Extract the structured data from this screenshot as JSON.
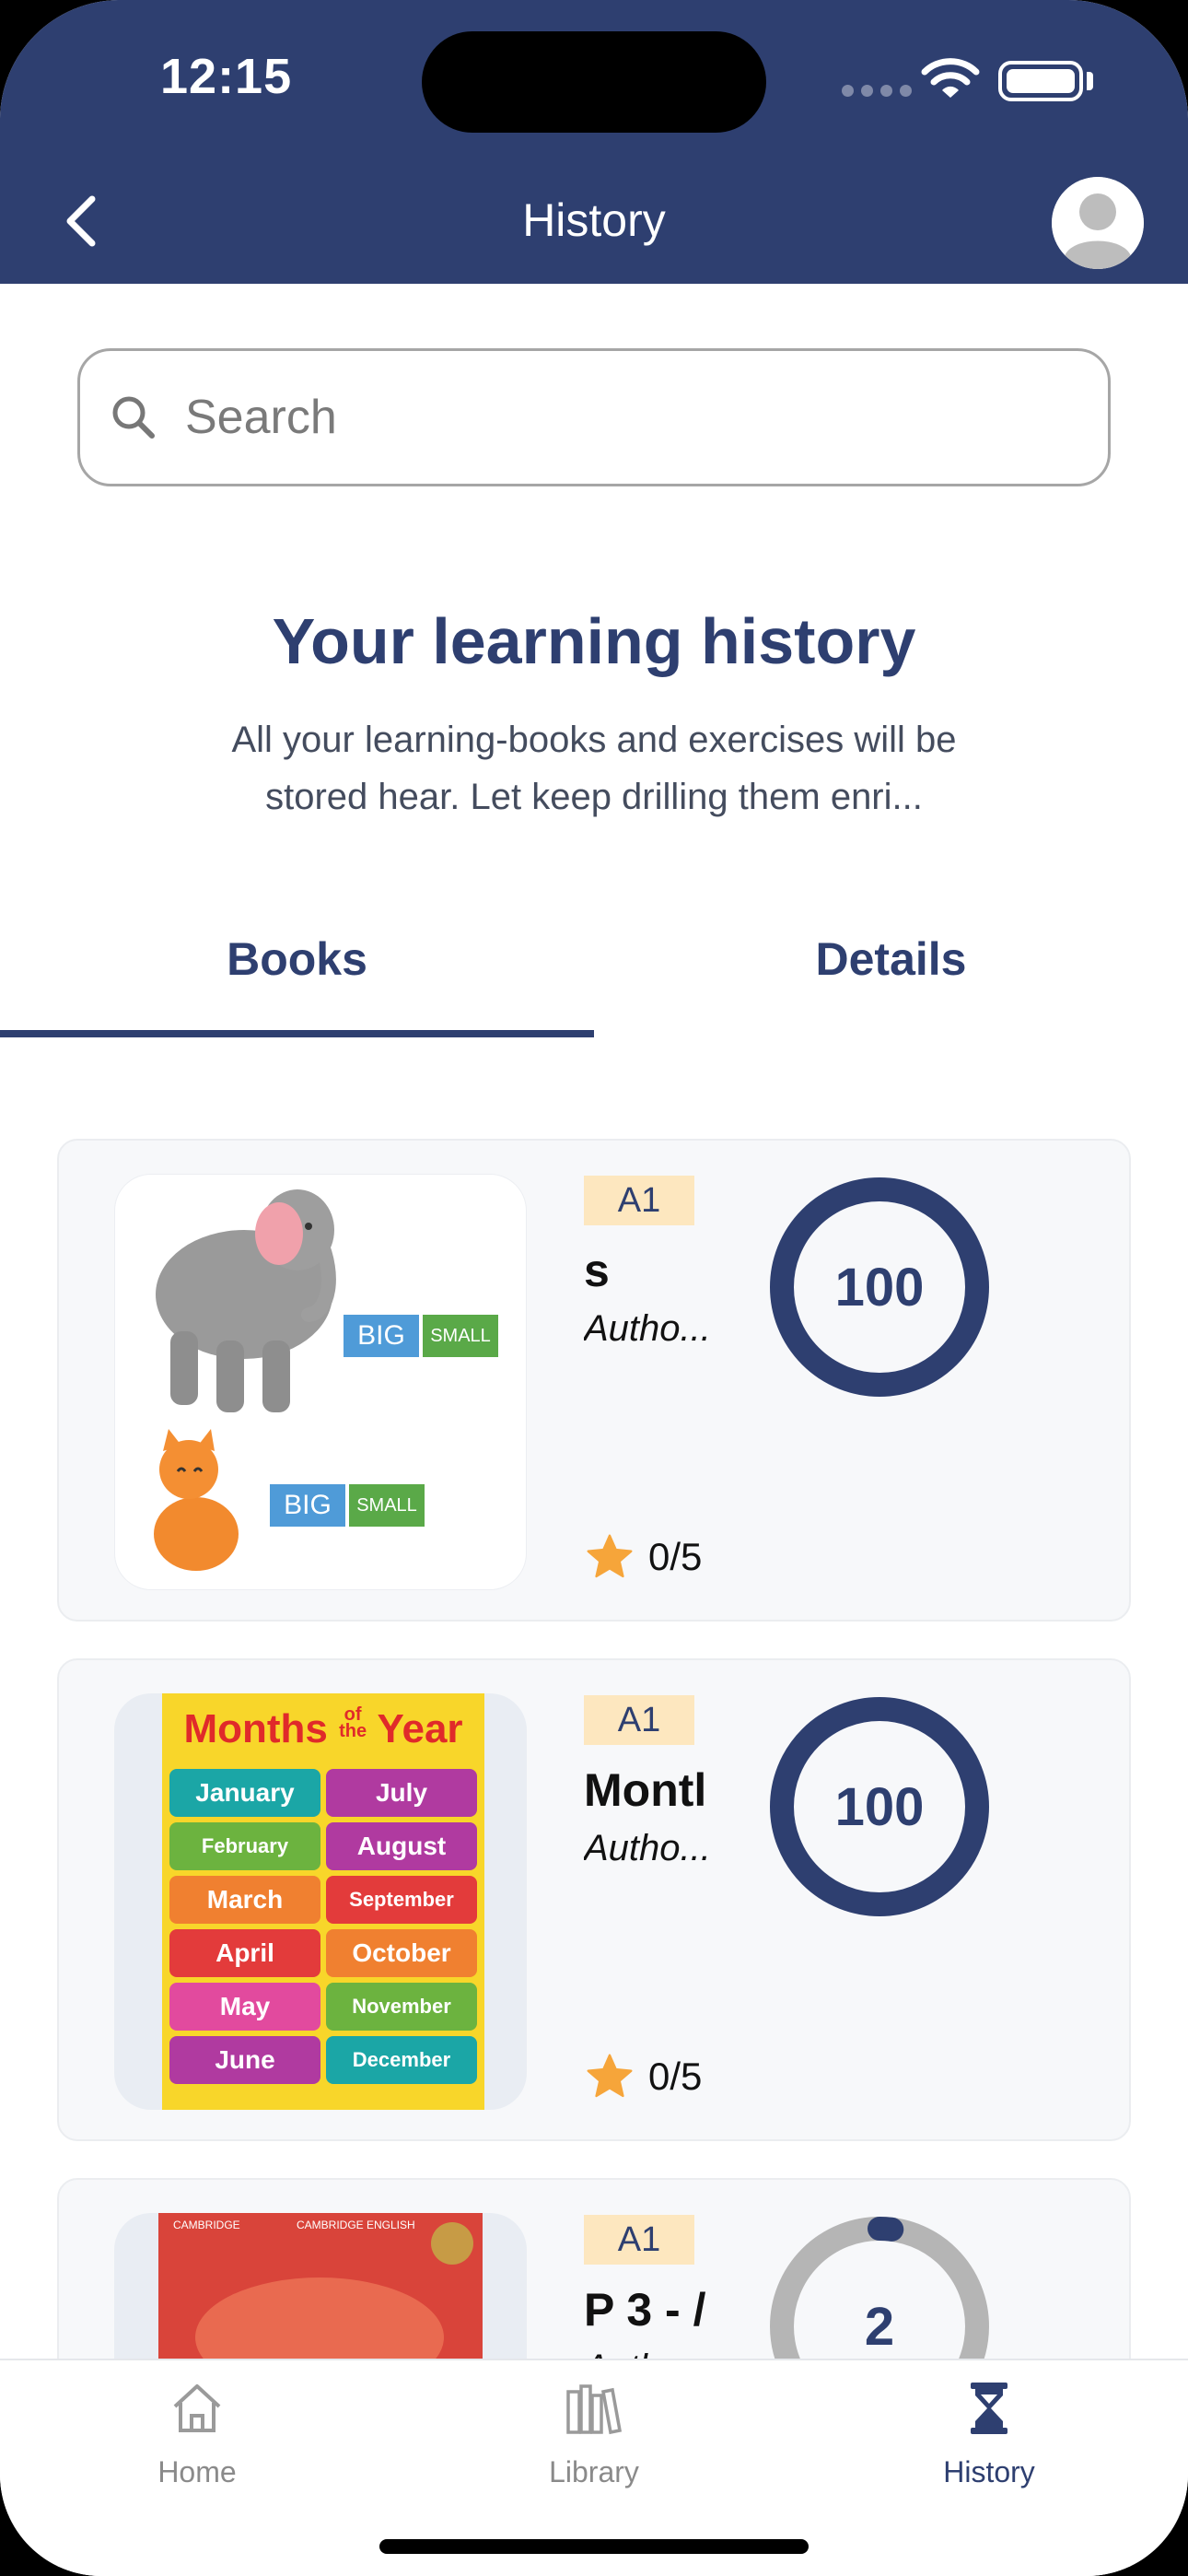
{
  "status_bar": {
    "time": "12:15"
  },
  "header": {
    "title": "History"
  },
  "search": {
    "placeholder": "Search"
  },
  "hero": {
    "title": "Your learning history",
    "description": "All your learning-books and exercises will be stored hear. Let keep drilling them enri..."
  },
  "tabs": [
    {
      "label": "Books",
      "active": true
    },
    {
      "label": "Details",
      "active": false
    }
  ],
  "books": [
    {
      "level": "A1",
      "title": "s",
      "author": "Autho...",
      "rating": "0/5",
      "progress": "100",
      "thumb_labels": {
        "big": "BIG",
        "small": "SMALL"
      }
    },
    {
      "level": "A1",
      "title": "Montl",
      "author": "Autho...",
      "rating": "0/5",
      "progress": "100",
      "thumb": {
        "title_a": "Months",
        "title_of": "of",
        "title_the": "the",
        "title_b": "Year",
        "months": [
          "January",
          "July",
          "February",
          "August",
          "March",
          "September",
          "April",
          "October",
          "May",
          "November",
          "June",
          "December"
        ]
      }
    },
    {
      "level": "A1",
      "title": "P 3 - /",
      "author": "Autho...",
      "progress": "2",
      "thumb": {
        "publisher_a": "CAMBRIDGE",
        "publisher_b": "CAMBRIDGE ENGLISH"
      }
    }
  ],
  "bottom_nav": [
    {
      "label": "Home",
      "icon": "home-icon",
      "active": false
    },
    {
      "label": "Library",
      "icon": "library-icon",
      "active": false
    },
    {
      "label": "History",
      "icon": "hourglass-icon",
      "active": true
    }
  ],
  "colors": {
    "primary": "#2e3f70",
    "level_badge": "#fde7bf",
    "star": "#f6a53a",
    "progress_track": "#b5b5b5"
  }
}
